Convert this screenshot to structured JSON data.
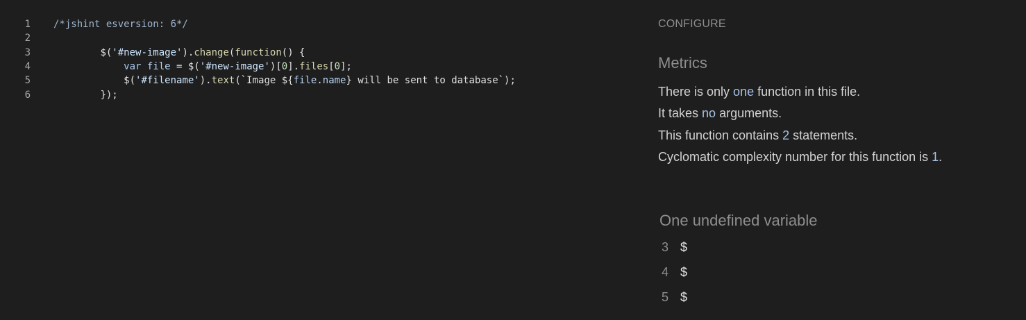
{
  "editor": {
    "lines": [
      {
        "n": "1",
        "indent": "",
        "tokens": [
          {
            "t": "/*jshint esversion: 6*/",
            "c": "comment"
          }
        ]
      },
      {
        "n": "2",
        "indent": "",
        "tokens": []
      },
      {
        "n": "3",
        "indent": "        ",
        "tokens": [
          {
            "t": "$(",
            "c": "ident"
          },
          {
            "t": "'#new-image'",
            "c": "str"
          },
          {
            "t": ").",
            "c": "punc"
          },
          {
            "t": "change",
            "c": "method"
          },
          {
            "t": "(",
            "c": "punc"
          },
          {
            "t": "function",
            "c": "method"
          },
          {
            "t": "() {",
            "c": "punc"
          }
        ]
      },
      {
        "n": "4",
        "indent": "            ",
        "tokens": [
          {
            "t": "var",
            "c": "keyword"
          },
          {
            "t": " ",
            "c": "punc"
          },
          {
            "t": "file",
            "c": "var"
          },
          {
            "t": " = $(",
            "c": "punc"
          },
          {
            "t": "'#new-image'",
            "c": "str"
          },
          {
            "t": ")[",
            "c": "punc"
          },
          {
            "t": "0",
            "c": "num"
          },
          {
            "t": "].",
            "c": "punc"
          },
          {
            "t": "files",
            "c": "method"
          },
          {
            "t": "[",
            "c": "punc"
          },
          {
            "t": "0",
            "c": "num"
          },
          {
            "t": "];",
            "c": "punc"
          }
        ]
      },
      {
        "n": "5",
        "indent": "            ",
        "tokens": [
          {
            "t": "$(",
            "c": "ident"
          },
          {
            "t": "'#filename'",
            "c": "str"
          },
          {
            "t": ").",
            "c": "punc"
          },
          {
            "t": "text",
            "c": "method"
          },
          {
            "t": "(`Image ${",
            "c": "punc"
          },
          {
            "t": "file",
            "c": "var"
          },
          {
            "t": ".",
            "c": "punc"
          },
          {
            "t": "name",
            "c": "var"
          },
          {
            "t": "} will be sent to database`);",
            "c": "punc"
          }
        ]
      },
      {
        "n": "6",
        "indent": "        ",
        "tokens": [
          {
            "t": "});",
            "c": "punc"
          }
        ]
      }
    ]
  },
  "panel": {
    "configure_label": "CONFIGURE",
    "metrics_title": "Metrics",
    "metrics": [
      {
        "parts": [
          {
            "t": "There is only "
          },
          {
            "t": "one",
            "hl": true
          },
          {
            "t": " function in this file."
          }
        ]
      },
      {
        "parts": [
          {
            "t": "It takes "
          },
          {
            "t": "no",
            "hl": true
          },
          {
            "t": " arguments."
          }
        ]
      },
      {
        "parts": [
          {
            "t": "This function contains "
          },
          {
            "t": "2",
            "hl": true
          },
          {
            "t": " statements."
          }
        ]
      },
      {
        "parts": [
          {
            "t": "Cyclomatic complexity number for this function is "
          },
          {
            "t": "1",
            "hl": true
          },
          {
            "t": "."
          }
        ]
      }
    ],
    "undefined_title": "One undefined variable",
    "undefined_vars": [
      {
        "line": "3",
        "name": "$"
      },
      {
        "line": "4",
        "name": "$"
      },
      {
        "line": "5",
        "name": "$"
      }
    ]
  },
  "colors": {
    "background": "#1e1e1e",
    "highlight": "#a8c2e6",
    "muted": "#8e8e8e",
    "text": "#d2d2d2"
  }
}
